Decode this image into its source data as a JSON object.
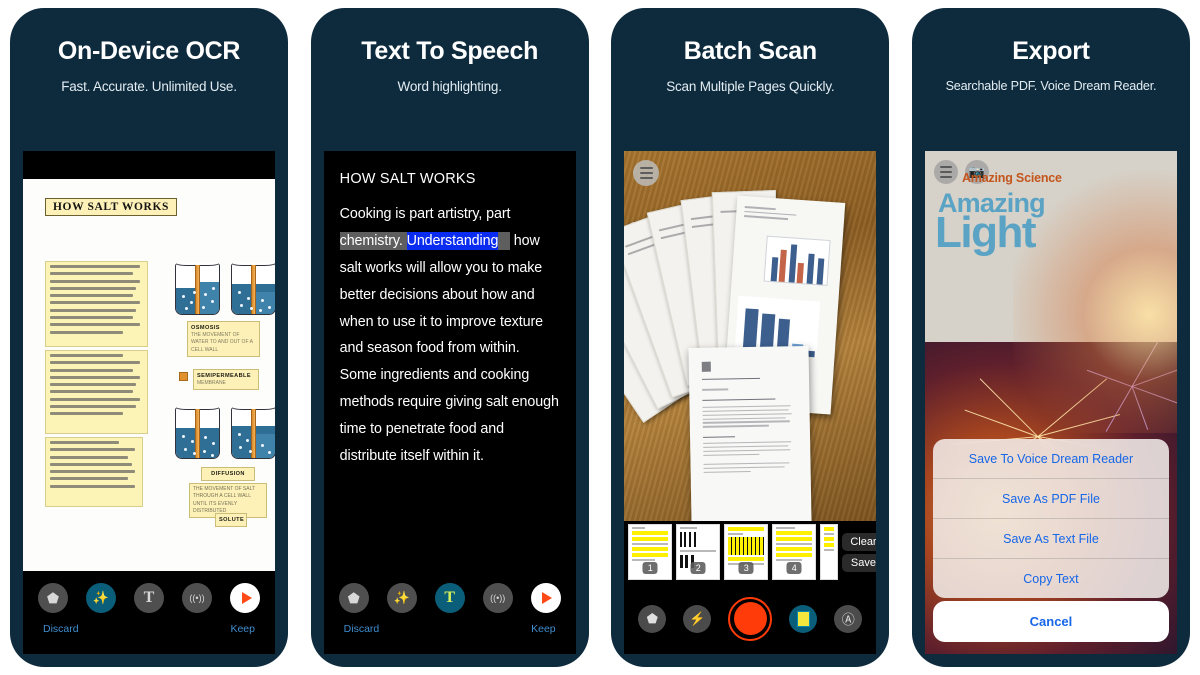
{
  "theme": {
    "frame_color": "#0e2b3d",
    "accent_blue": "#3f8ed0",
    "link_blue": "#1666e8",
    "highlight_word": "#0a2cf0",
    "highlight_sentence": "#5e5e5e",
    "shutter_red": "#ff3b0a",
    "teal_active": "#0b5e79"
  },
  "panels": [
    {
      "id": "ocr",
      "title": "On-Device OCR",
      "subtitle": "Fast. Accurate. Unlimited Use.",
      "document": {
        "title": "HOW SALT WORKS",
        "diagram_labels": [
          {
            "heading": "OSMOSIS",
            "text": "THE MOVEMENT OF WATER TO AND OUT OF A CELL WALL"
          },
          {
            "heading": "SEMIPERMEABLE",
            "text": "MEMBRANE"
          },
          {
            "heading": "DIFFUSION",
            "text": "THE MOVEMENT OF SALT THROUGH A CELL WALL UNTIL ITS EVENLY DISTRIBUTED"
          },
          {
            "heading": "SOLUTE",
            "text": ""
          }
        ]
      },
      "toolbar": {
        "icons": [
          {
            "name": "crop-icon",
            "glyph": "⬟",
            "state": "inactive"
          },
          {
            "name": "magic-wand-icon",
            "glyph": "✨",
            "state": "active"
          },
          {
            "name": "text-icon",
            "glyph": "T",
            "state": "inactive"
          },
          {
            "name": "speaker-icon",
            "glyph": "((•))",
            "state": "inactive"
          },
          {
            "name": "play-icon",
            "glyph": "▶",
            "state": "play"
          }
        ],
        "discard_label": "Discard",
        "keep_label": "Keep"
      }
    },
    {
      "id": "tts",
      "title": "Text To Speech",
      "subtitle": "Word highlighting.",
      "reader": {
        "heading": "HOW SALT WORKS",
        "before_highlight": "Cooking is part artistry, part ",
        "sentence_highlight_lead": "chemistry. ",
        "word_highlight": "Understanding",
        "after_highlight": " how salt works will allow you to make better decisions about how and when to use it to improve texture and season food from within. Some ingredients and cooking methods require giving salt enough time to penetrate food and distribute itself within it."
      },
      "toolbar": {
        "icons": [
          {
            "name": "crop-icon",
            "glyph": "⬟",
            "state": "inactive"
          },
          {
            "name": "magic-wand-icon",
            "glyph": "✨",
            "state": "inactive"
          },
          {
            "name": "text-icon",
            "glyph": "T",
            "state": "active"
          },
          {
            "name": "speaker-icon",
            "glyph": "((•))",
            "state": "inactive"
          },
          {
            "name": "play-icon",
            "glyph": "▶",
            "state": "play"
          }
        ],
        "discard_label": "Discard",
        "keep_label": "Keep"
      }
    },
    {
      "id": "batch",
      "title": "Batch Scan",
      "subtitle": "Scan Multiple Pages Quickly.",
      "thumbnails": [
        {
          "number": "1"
        },
        {
          "number": "2"
        },
        {
          "number": "3"
        },
        {
          "number": "4"
        },
        {
          "number": ""
        }
      ],
      "strip_buttons": {
        "clear_label": "Clear",
        "save_label": "Save"
      },
      "camera_toolbar": [
        {
          "name": "perspective-icon",
          "glyph": "⬟"
        },
        {
          "name": "flash-icon",
          "glyph": "⚡"
        },
        {
          "name": "shutter-button",
          "glyph": ""
        },
        {
          "name": "pages-icon",
          "glyph": ""
        },
        {
          "name": "auto-capture-icon",
          "glyph": "Ⓐ"
        }
      ]
    },
    {
      "id": "export",
      "title": "Export",
      "subtitle": "Searchable PDF. Voice Dream Reader.",
      "cover": {
        "brand": "Amazing Science",
        "title_line1": "Amazing",
        "title_line2": "Light"
      },
      "action_sheet": {
        "items": [
          "Save To Voice Dream Reader",
          "Save As PDF File",
          "Save As Text File",
          "Copy Text"
        ],
        "cancel": "Cancel"
      }
    }
  ]
}
